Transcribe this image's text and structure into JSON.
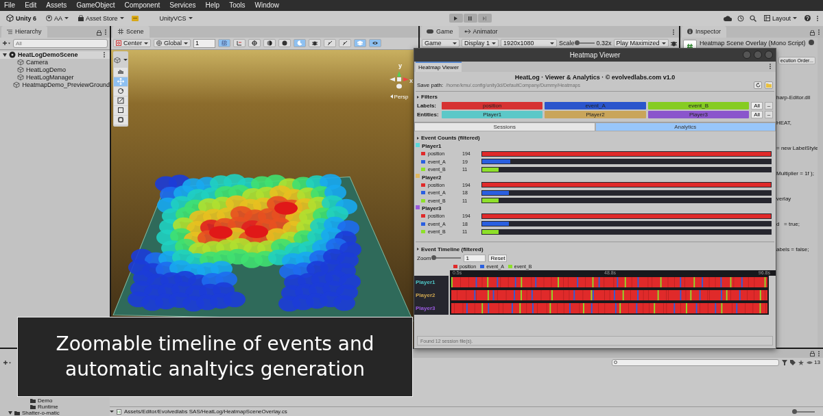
{
  "menu_bar": [
    "File",
    "Edit",
    "Assets",
    "GameObject",
    "Component",
    "Services",
    "Help",
    "Tools",
    "Window"
  ],
  "toolbar": {
    "unity_version": "Unity 6",
    "account": "AA",
    "asset_store": "Asset Store",
    "vcs": "UnityVCS",
    "layout": "Layout"
  },
  "hierarchy": {
    "title": "Hierarchy",
    "search_placeholder": "All",
    "tree": [
      {
        "label": "HeatLogDemoScene",
        "expanded": true,
        "selected": true,
        "children": [
          {
            "label": "Camera",
            "selected": false
          },
          {
            "label": "HeatLogDemo",
            "selected": false
          },
          {
            "label": "HeatLogManager",
            "selected": false
          },
          {
            "label": "HeatmapDemo_PreviewGround",
            "selected": false
          }
        ]
      }
    ]
  },
  "scene": {
    "tab": "Scene",
    "pivot": "Center",
    "space": "Global",
    "grid_value": "1",
    "gizmo_axes": [
      "y",
      "x"
    ],
    "projection": "Persp"
  },
  "game": {
    "tabs": [
      {
        "label": "Game",
        "selected": true
      },
      {
        "label": "Animator",
        "selected": false
      }
    ],
    "display_mode": "Game",
    "display": "Display 1",
    "resolution": "1920x1080",
    "scale_label": "Scale",
    "scale_slider": {
      "level": 0
    },
    "scale": "0.32x",
    "play_mode": "Play Maximized"
  },
  "inspector": {
    "title": "Inspector",
    "component": "Heatmap Scene Overlay (Mono Script)",
    "button": "ecution Order...",
    "lines": [
      "harp-Editor.dll",
      "HEAT,",
      "= new LabelStyle",
      "Multiplier = 1f );",
      "verlay",
      "d   = true;",
      "abels = false;"
    ]
  },
  "heatmap_viewer": {
    "window_title": "Heatmap Viewer",
    "tab": "Heatmap Viewer",
    "header": "HeatLog · Viewer & Analytics · © evolvedlabs.com  v1.0",
    "save_path_label": "Save path:",
    "save_path": "/home/kmu/.config/unity3d/DefaultCompany/Dummy/Heatmaps",
    "filters_title": "Filters",
    "filter_rows": [
      {
        "label": "Labels:",
        "chips": [
          {
            "label": "position",
            "color": "#d63232"
          },
          {
            "label": "event_A",
            "color": "#2a55cc"
          },
          {
            "label": "event_B",
            "color": "#86cc22"
          }
        ],
        "all": "All",
        "none": "–"
      },
      {
        "label": "Entities:",
        "chips": [
          {
            "label": "Player1",
            "color": "#5cc8c8"
          },
          {
            "label": "Player2",
            "color": "#c9a55a"
          },
          {
            "label": "Player3",
            "color": "#8a55cc"
          }
        ],
        "all": "All",
        "none": "–"
      }
    ],
    "view_tabs": [
      {
        "label": "Sessions",
        "selected": false
      },
      {
        "label": "Analytics",
        "selected": true
      }
    ],
    "event_counts": {
      "title": "Event Counts  (filtered)",
      "entities": [
        {
          "name": "Player1",
          "color": "#5ad8d8",
          "events": [
            {
              "label": "position",
              "color": "#e02a2a",
              "count": "194",
              "level": 1
            },
            {
              "label": "event_A",
              "color": "#2a5fe0",
              "count": "19",
              "level": 0.098
            },
            {
              "label": "event_B",
              "color": "#8ee02a",
              "count": "11",
              "level": 0.057
            }
          ]
        },
        {
          "name": "Player2",
          "color": "#e0b860",
          "events": [
            {
              "label": "position",
              "color": "#e02a2a",
              "count": "194",
              "level": 1
            },
            {
              "label": "event_A",
              "color": "#2a5fe0",
              "count": "18",
              "level": 0.093
            },
            {
              "label": "event_B",
              "color": "#8ee02a",
              "count": "11",
              "level": 0.057
            }
          ]
        },
        {
          "name": "Player3",
          "color": "#9a5ad8",
          "events": [
            {
              "label": "position",
              "color": "#e02a2a",
              "count": "194",
              "level": 1
            },
            {
              "label": "event_A",
              "color": "#2a5fe0",
              "count": "18",
              "level": 0.093
            },
            {
              "label": "event_B",
              "color": "#8ee02a",
              "count": "11",
              "level": 0.057
            }
          ]
        }
      ]
    },
    "timeline": {
      "title": "Event Timeline  (filtered)",
      "zoom_label": "Zoom",
      "zoom_slider": {
        "level": 0
      },
      "zoom_value": "1",
      "reset": "Reset",
      "legend": [
        {
          "label": "position",
          "color": "#e02a2a"
        },
        {
          "label": "event_A",
          "color": "#2a5fe0"
        },
        {
          "label": "event_B",
          "color": "#8ee02a"
        }
      ],
      "axis_labels": [
        "0.5s",
        "48.8s",
        "96.8s"
      ],
      "tracks": [
        {
          "name": "Player1",
          "color": "#4fc8c8"
        },
        {
          "name": "Player2",
          "color": "#d0a850"
        },
        {
          "name": "Player3",
          "color": "#9a5ae0"
        }
      ]
    },
    "status": "Found 12 session file(s)."
  },
  "project": {
    "folders": [
      {
        "label": "Demo",
        "kind": "nested"
      },
      {
        "label": "Runtime",
        "kind": "nested"
      },
      {
        "label": "Shatter-o-matic",
        "kind": "root",
        "expanded": true
      }
    ],
    "hidden_count": "13",
    "path": "Assets/Editor/Evolvedlabs SAS/HeatLog/HeatmapSceneOverlay.cs",
    "icon_size_slider": {
      "level": 0
    }
  },
  "caption": "Zoomable timeline of events and\nautomatic analtyics generation"
}
